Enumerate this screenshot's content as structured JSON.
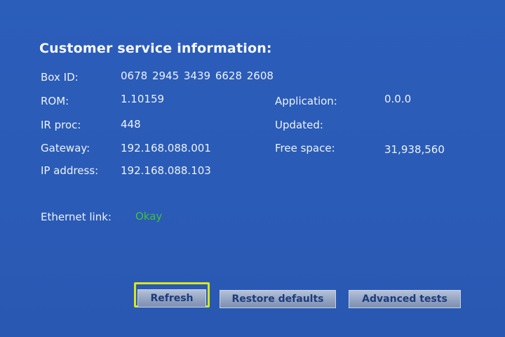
{
  "title": "Customer service information:",
  "box_id": {
    "label": "Box ID:",
    "value": "0678 2945 3439 6628 2608"
  },
  "rom": {
    "label": "ROM:",
    "value": "1.10159"
  },
  "ir_proc": {
    "label": "IR proc:",
    "value": "448"
  },
  "gateway": {
    "label": "Gateway:",
    "value": "192.168.088.001"
  },
  "ip_address": {
    "label": "IP address:",
    "value": "192.168.088.103"
  },
  "application": {
    "label": "Application:",
    "value": "0.0.0"
  },
  "updated": {
    "label": "Updated:",
    "value": ""
  },
  "free_space": {
    "label": "Free space:",
    "value": "31,938,560"
  },
  "ethernet": {
    "label": "Ethernet link:",
    "status": "Okay",
    "status_color": "#3ec23a"
  },
  "buttons": {
    "refresh": "Refresh",
    "restore_defaults": "Restore defaults",
    "advanced_tests": "Advanced tests"
  },
  "colors": {
    "background": "#2a5cb8",
    "text": "#f2f4f8",
    "focus": "#d9e61c",
    "button_text": "#1c3c7c"
  }
}
